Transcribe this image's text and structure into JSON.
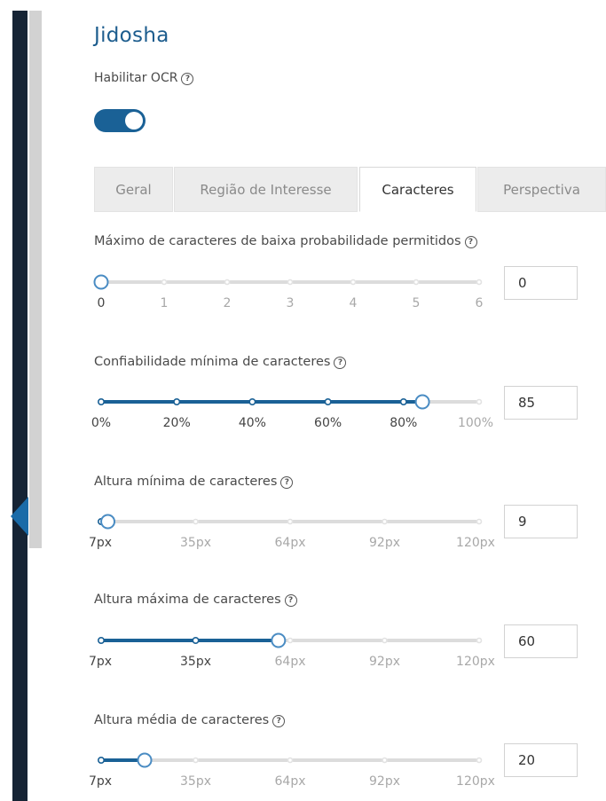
{
  "title": "Jidosha",
  "ocr": {
    "label": "Habilitar OCR",
    "enabled": true
  },
  "help_icon": "question-circle-icon",
  "tabs": [
    {
      "label": "Geral",
      "active": false
    },
    {
      "label": "Região de Interesse",
      "active": false
    },
    {
      "label": "Caracteres",
      "active": true
    },
    {
      "label": "Perspectiva",
      "active": false
    }
  ],
  "sliders": [
    {
      "label": "Máximo de caracteres de baixa probabilidade permitidos",
      "value": "0",
      "min": 0,
      "max": 6,
      "current": 0,
      "ticks": [
        "0",
        "1",
        "2",
        "3",
        "4",
        "5",
        "6"
      ]
    },
    {
      "label": "Confiabilidade mínima de caracteres",
      "value": "85",
      "min": 0,
      "max": 100,
      "current": 85,
      "ticks": [
        "0%",
        "20%",
        "40%",
        "60%",
        "80%",
        "100%"
      ]
    },
    {
      "label": "Altura mínima de caracteres",
      "value": "9",
      "min": 7,
      "max": 120,
      "current": 9,
      "ticks": [
        "7px",
        "35px",
        "64px",
        "92px",
        "120px"
      ]
    },
    {
      "label": "Altura máxima de caracteres",
      "value": "60",
      "min": 7,
      "max": 120,
      "current": 60,
      "ticks": [
        "7px",
        "35px",
        "64px",
        "92px",
        "120px"
      ]
    },
    {
      "label": "Altura média de caracteres",
      "value": "20",
      "min": 7,
      "max": 120,
      "current": 20,
      "ticks": [
        "7px",
        "35px",
        "64px",
        "92px",
        "120px"
      ]
    }
  ],
  "colors": {
    "accent": "#1a6196",
    "title": "#1d5d8e",
    "track": "#dcdcdc",
    "tick_inactive": "#a8a8a8",
    "tick_active": "#444444"
  }
}
